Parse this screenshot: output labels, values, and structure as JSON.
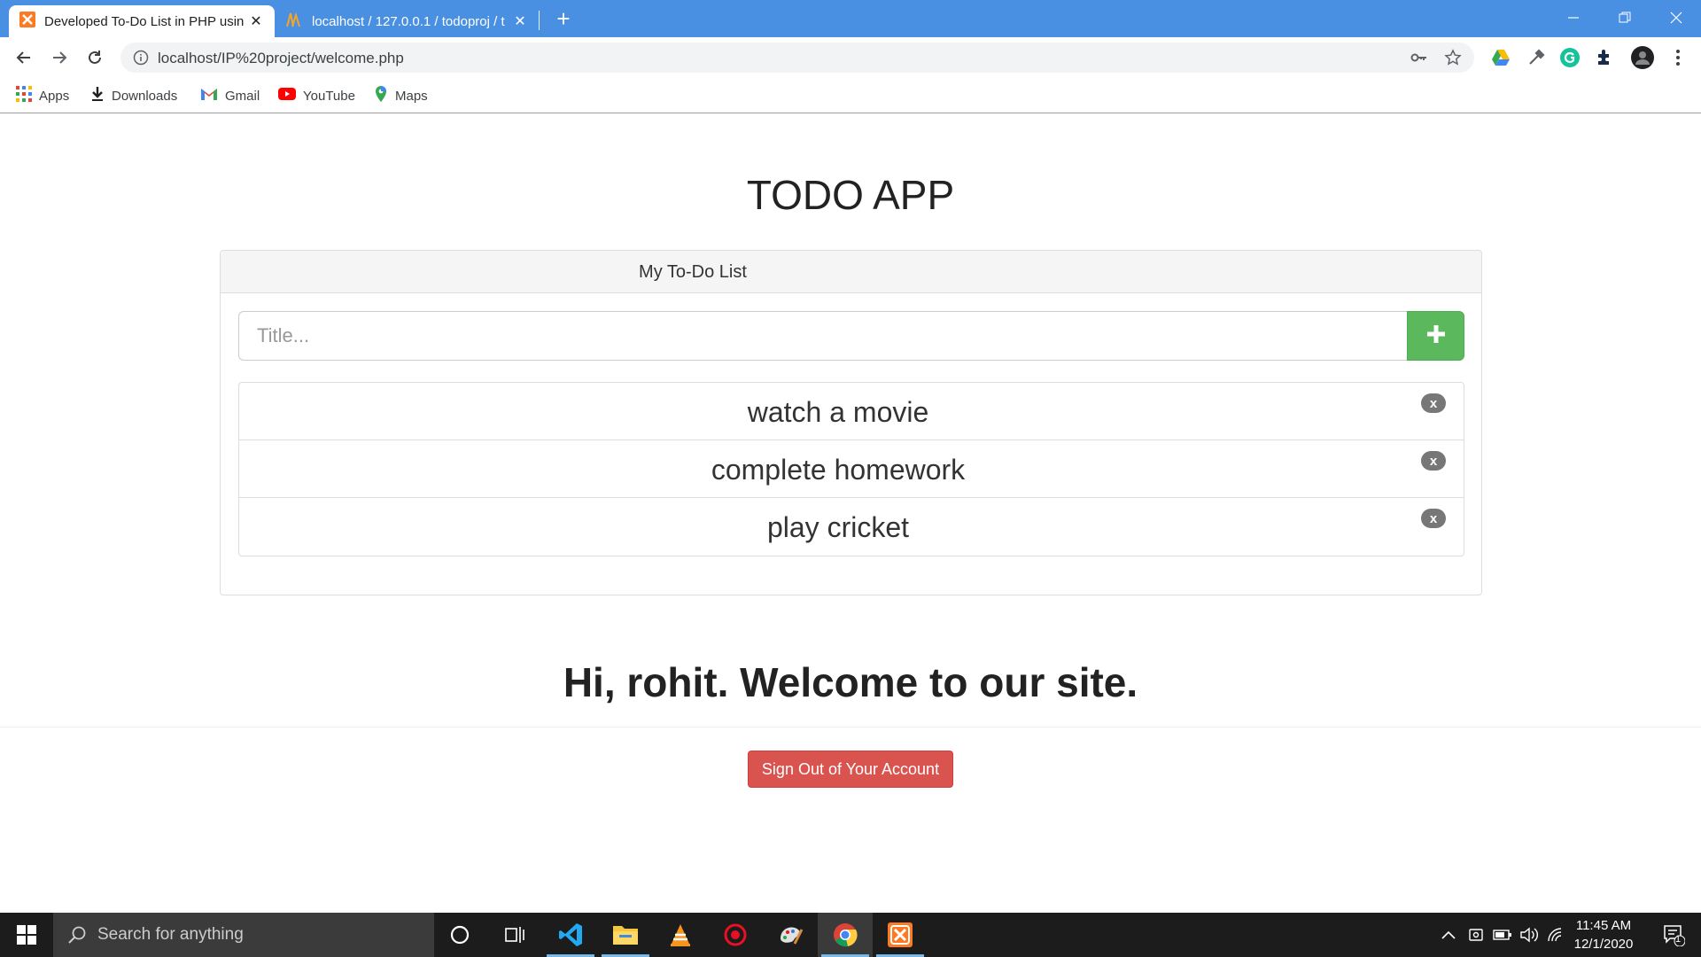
{
  "browser": {
    "tabs": [
      {
        "title": "Developed To-Do List in PHP usin",
        "active": true,
        "icon": "xampp-icon"
      },
      {
        "title": "localhost / 127.0.0.1 / todoproj / t",
        "active": false,
        "icon": "phpmyadmin-icon"
      }
    ],
    "url": "localhost/IP%20project/welcome.php",
    "bookmarks": [
      {
        "label": "Apps",
        "icon": "apps-grid-icon"
      },
      {
        "label": "Downloads",
        "icon": "download-icon"
      },
      {
        "label": "Gmail",
        "icon": "gmail-icon"
      },
      {
        "label": "YouTube",
        "icon": "youtube-icon"
      },
      {
        "label": "Maps",
        "icon": "maps-icon"
      }
    ]
  },
  "page": {
    "title": "TODO APP",
    "panel_title": "My To-Do List",
    "input_placeholder": "Title...",
    "add_label": "+",
    "todos": [
      {
        "text": "watch a movie",
        "delete": "x"
      },
      {
        "text": "complete homework",
        "delete": "x"
      },
      {
        "text": "play cricket",
        "delete": "x"
      }
    ],
    "welcome_prefix": "Hi, ",
    "username": "rohit",
    "welcome_suffix": ". Welcome to our site.",
    "signout_label": "Sign Out of Your Account"
  },
  "taskbar": {
    "search_placeholder": "Search for anything",
    "time": "11:45 AM",
    "date": "12/1/2020",
    "notification_count": "1"
  },
  "colors": {
    "tabstrip": "#4a90e2",
    "add_button": "#5cb85c",
    "signout_button": "#d9534f",
    "badge": "#777777"
  }
}
